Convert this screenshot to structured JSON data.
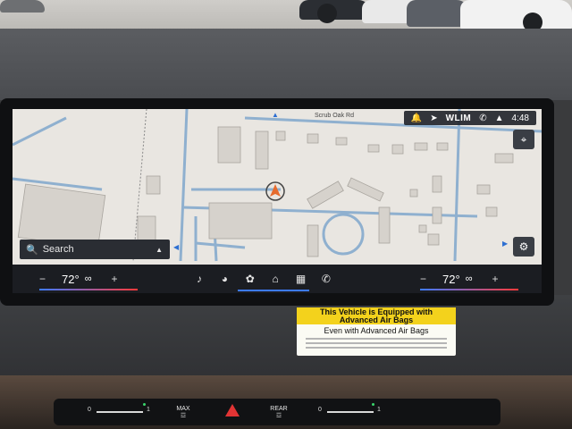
{
  "status_bar": {
    "station": "WLIM",
    "time": "4:48",
    "icons": [
      "bell-icon",
      "location-arrow-icon",
      "phone-muted-icon",
      "signal-icon"
    ]
  },
  "map": {
    "street_label": "Scrub Oak Rd",
    "search_placeholder": "Search",
    "colors": {
      "land": "#e9e6e1",
      "road": "#8fb0cf",
      "building": "#d6d2cc",
      "accent": "#2d6fd2"
    }
  },
  "climate_screen": {
    "left_temp": "72°",
    "right_temp": "72°",
    "minus": "−",
    "plus": "+"
  },
  "nav_bar": {
    "icons": [
      "music-icon",
      "gauge-icon",
      "fan-icon",
      "home-icon",
      "apps-grid-icon",
      "phone-icon"
    ]
  },
  "sticker": {
    "line1": "This Vehicle is Equipped with",
    "line2": "Advanced Air Bags",
    "line3": "Even with Advanced Air Bags"
  },
  "climate_strip": {
    "left_min": "0",
    "left_max": "1",
    "max_label": "MAX",
    "rear_label": "REAR",
    "right_min": "0",
    "right_max": "1"
  }
}
